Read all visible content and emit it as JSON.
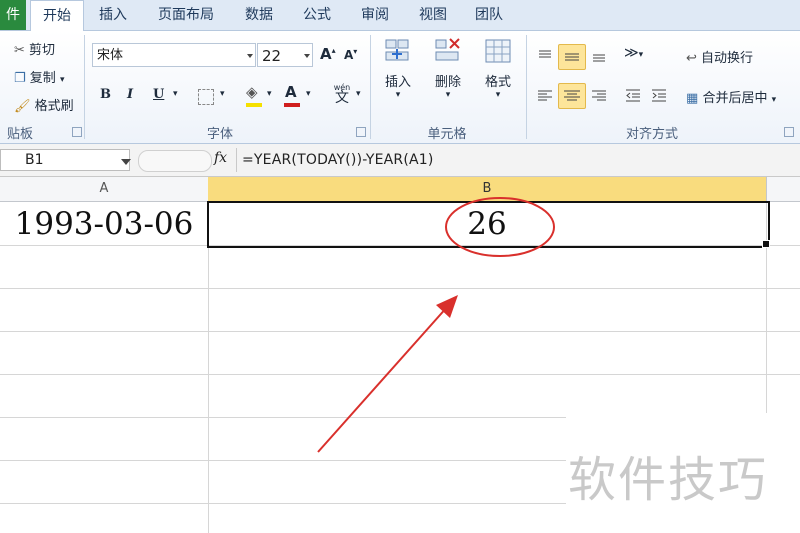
{
  "tabs": {
    "file": "件",
    "home": "开始",
    "insert": "插入",
    "page_layout": "页面布局",
    "data": "数据",
    "formulas": "公式",
    "review": "审阅",
    "view": "视图",
    "team": "团队"
  },
  "clipboard": {
    "cut": "剪切",
    "copy": "复制",
    "format_painter": "格式刷",
    "group_label": "贴板"
  },
  "font": {
    "name": "宋体",
    "size": "22",
    "grow": "A",
    "shrink": "A",
    "bold": "B",
    "italic": "I",
    "underline": "U",
    "font_color_letter": "A",
    "phonetic": "wén",
    "group_label": "字体"
  },
  "cells": {
    "insert": "插入",
    "delete": "删除",
    "format": "格式",
    "group_label": "单元格"
  },
  "alignment": {
    "wrap_text": "自动换行",
    "merge_center": "合并后居中",
    "group_label": "对齐方式"
  },
  "formula_bar": {
    "name_box": "B1",
    "fx": "fx",
    "formula": "=YEAR(TODAY())-YEAR(A1)"
  },
  "grid": {
    "col_a": "A",
    "col_b": "B",
    "a1_value": "1993-03-06",
    "b1_value": "26"
  },
  "watermark": "软件技巧",
  "colors": {
    "selected_col_header": "#f9dc7e",
    "annotation_red": "#d9302c",
    "file_tab": "#2a8a3e"
  }
}
